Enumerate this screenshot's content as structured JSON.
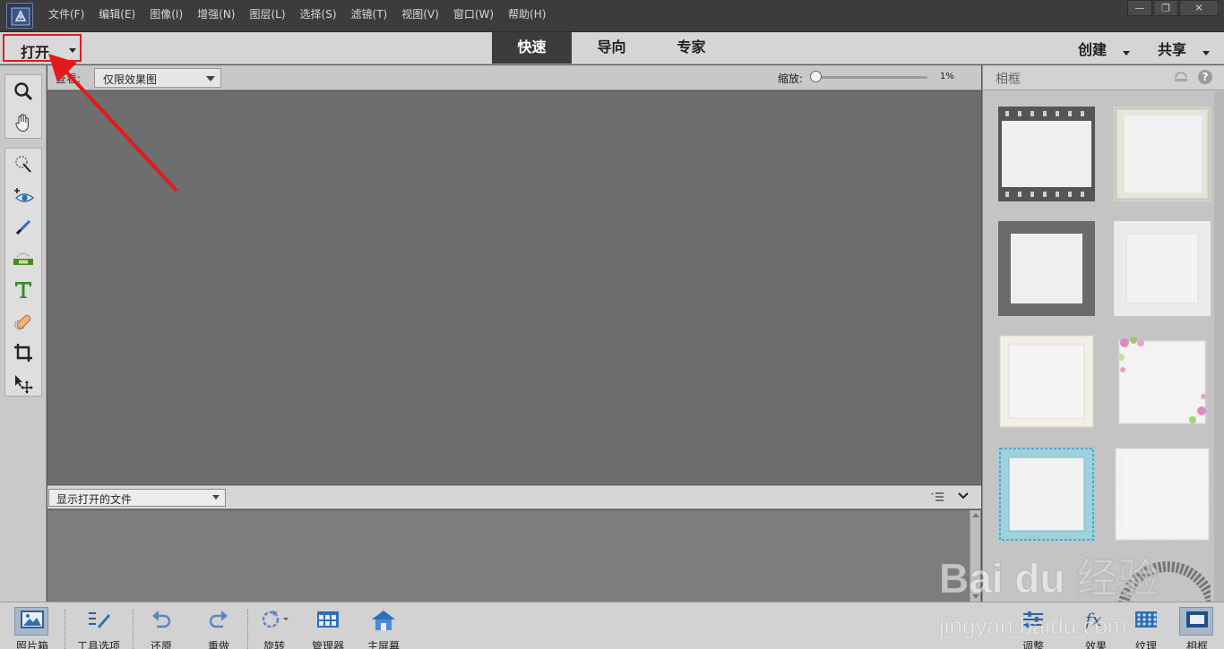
{
  "menubar": {
    "items": [
      "文件(F)",
      "编辑(E)",
      "图像(I)",
      "增强(N)",
      "图层(L)",
      "选择(S)",
      "滤镜(T)",
      "视图(V)",
      "窗口(W)",
      "帮助(H)"
    ]
  },
  "modebar": {
    "open_label": "打开",
    "tabs": [
      "快速",
      "导向",
      "专家"
    ],
    "active_tab": "快速",
    "create_label": "创建",
    "share_label": "共享"
  },
  "options": {
    "view_label": "查看:",
    "view_value": "仅限效果图",
    "zoom_label": "缩放:",
    "zoom_value": "1%",
    "zoom_level_percent": 1
  },
  "photo_bin": {
    "select_value": "显示打开的文件"
  },
  "right_panel": {
    "title": "相框"
  },
  "bottom_bar": {
    "photo_bin": "照片箱",
    "tool_options": "工具选项",
    "undo": "还原",
    "redo": "重做",
    "rotate": "旋转",
    "organizer": "管理器",
    "home_screen": "主屏幕",
    "adjust": "调整",
    "effects": "效果",
    "textures": "纹理",
    "frames": "相框"
  },
  "watermark": {
    "brand": "Bai du 经验",
    "url": "jingyan.baidu.com"
  },
  "colors": {
    "menubar_bg": "#3c3c3c",
    "annotation_red": "#e3191b",
    "canvas_bg": "#6e6e6e",
    "tool_accent_green": "#4a8a22",
    "tool_accent_blue": "#2f6eb5"
  }
}
